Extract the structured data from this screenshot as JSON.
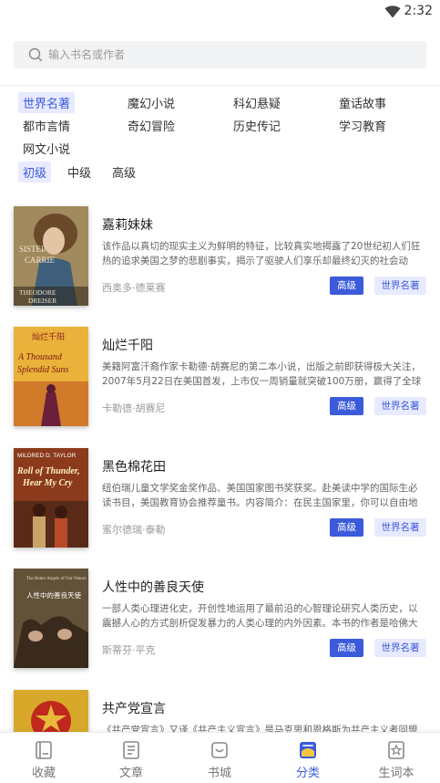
{
  "status_bar": {
    "time": "2:32"
  },
  "search": {
    "placeholder": "输入书名或作者"
  },
  "genres": [
    {
      "label": "世界名著",
      "active": true
    },
    {
      "label": "魔幻小说",
      "active": false
    },
    {
      "label": "科幻悬疑",
      "active": false
    },
    {
      "label": "童话故事",
      "active": false
    },
    {
      "label": "都市言情",
      "active": false
    },
    {
      "label": "奇幻冒险",
      "active": false
    },
    {
      "label": "历史传记",
      "active": false
    },
    {
      "label": "学习教育",
      "active": false
    },
    {
      "label": "网文小说",
      "active": false
    }
  ],
  "levels": [
    {
      "label": "初级",
      "active": true
    },
    {
      "label": "中级",
      "active": false
    },
    {
      "label": "高级",
      "active": false
    }
  ],
  "books": [
    {
      "title": "嘉莉妹妹",
      "description": "该作品以真切的现实主义为鲜明的特征，比较真实地揭露了20世纪初人们狂热的追求美国之梦的悲剧事实，揭示了驱驶人们享乐却最终幻灭的社会动因。",
      "author": "西奥多·德莱赛",
      "level": "高级",
      "category": "世界名著",
      "cover_text": [
        "SISTER",
        "CARRIE",
        "THEODORE",
        "DREISER"
      ]
    },
    {
      "title": "灿烂千阳",
      "description": "美籍阿富汗裔作家卡勒德·胡赛尼的第二本小说，出版之前即获得极大关注，2007年5月22日在美国首发，上市仅一周销量就突破100万册，赢得了全球读者的喜爱。",
      "author": "卡勒德·胡赛尼",
      "level": "高级",
      "category": "世界名著",
      "cover_text": [
        "灿烂千阳",
        "A Thousand",
        "Splendid Suns"
      ]
    },
    {
      "title": "黑色棉花田",
      "description": "纽伯瑞儿童文学奖金奖作品、美国国家图书奖获奖。赴美读中学的国际生必读书目，美国教育协会推荐童书。内容简介：在民主国家里，你可以自由地发表意见。",
      "author": "蜜尔德瑞·泰勒",
      "level": "高级",
      "category": "世界名著",
      "cover_text": [
        "MILDRED D. TAYLOR",
        "Roll of Thunder,",
        "Hear My Cry"
      ]
    },
    {
      "title": "人性中的善良天使",
      "description": "一部人类心理进化史，开创性地运用了最前沿的心智理论研究人类历史，以震撼人心的方式剖析促发暴力的人类心理的内外因素。本书的作者是哈佛大学心理学教授。",
      "author": "斯蒂芬·平克",
      "level": "高级",
      "category": "世界名著",
      "cover_text": [
        "The Better Angels of Our Nature",
        "人性中的善良天使"
      ]
    },
    {
      "title": "共产党宣言",
      "description": "《共产党宣言》又译《共产主义宣言》是马克思和恩格斯为共产主义者同盟起草的纲领。",
      "author": "",
      "level": "",
      "category": "",
      "cover_text": []
    }
  ],
  "bottom_nav": [
    {
      "label": "收藏",
      "icon": "collection-icon",
      "active": false
    },
    {
      "label": "文章",
      "icon": "article-icon",
      "active": false
    },
    {
      "label": "书城",
      "icon": "bookstore-icon",
      "active": false
    },
    {
      "label": "分类",
      "icon": "category-icon",
      "active": true
    },
    {
      "label": "生词本",
      "icon": "vocabulary-icon",
      "active": false
    }
  ],
  "colors": {
    "accent": "#3b5bdb",
    "accent_light": "#e8eaff"
  }
}
